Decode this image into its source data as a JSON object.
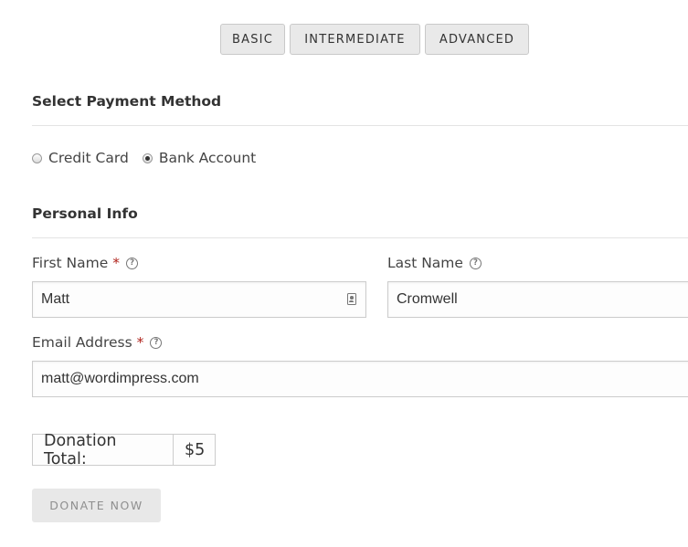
{
  "level_tabs": [
    {
      "label": "BASIC"
    },
    {
      "label": "INTERMEDIATE"
    },
    {
      "label": "ADVANCED"
    }
  ],
  "payment_section": {
    "heading": "Select Payment Method",
    "options": [
      {
        "label": "Credit Card",
        "selected": false
      },
      {
        "label": "Bank Account",
        "selected": true
      }
    ]
  },
  "personal_info": {
    "heading": "Personal Info",
    "first_name": {
      "label": "First Name",
      "required_mark": "*",
      "value": "Matt"
    },
    "last_name": {
      "label": "Last Name",
      "value": "Cromwell"
    },
    "email": {
      "label": "Email Address",
      "required_mark": "*",
      "value": "matt@wordimpress.com"
    }
  },
  "help_icon_glyph": "?",
  "donation_total": {
    "label": "Donation Total:",
    "amount": "$5"
  },
  "donate_button": {
    "label": "DONATE NOW"
  },
  "colors": {
    "required": "#b0231c",
    "button_bg": "#e8e8e8",
    "button_text": "#8f8f8f"
  }
}
